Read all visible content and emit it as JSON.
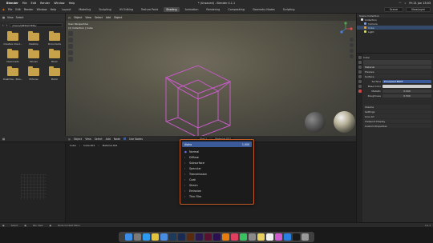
{
  "menubar": {
    "app_name": "Blender",
    "items": [
      "File",
      "Edit",
      "Render",
      "Window",
      "Help"
    ],
    "title": "* (Unsaved) - Blender 4.1.1",
    "clock": "Fri 21 Jun 13:03"
  },
  "topbar": {
    "menus": [
      "File",
      "Edit",
      "Render",
      "Window",
      "Help"
    ],
    "tabs": [
      "Layout",
      "Modeling",
      "Sculpting",
      "UV Editing",
      "Texture Paint",
      "Shading",
      "Animation",
      "Rendering",
      "Compositing",
      "Geometry Nodes",
      "Scripting"
    ],
    "active_tab": "Shading",
    "scene": "Scene",
    "view_layer": "ViewLayer"
  },
  "filebrowser": {
    "menus": [
      "View",
      "Select"
    ],
    "path": "/Users/[REDACTED]/",
    "folders": [
      "Creative Cloud...",
      "Desktop",
      "Documents",
      "Downloads",
      "Movies",
      "Music",
      "OneDrive - Pers...",
      "Pictures",
      "Public"
    ]
  },
  "viewport": {
    "menus": [
      "Object",
      "View",
      "Select",
      "Add",
      "Object"
    ],
    "info_line1": "User Perspective",
    "info_line2": "(1) Collection | Cube"
  },
  "outliner": {
    "title": "Scene Collection",
    "rows": [
      "Collection",
      "Camera",
      "Cube",
      "Light"
    ]
  },
  "properties": {
    "object_name": "Cube",
    "material": "Material",
    "sections": [
      "Preview",
      "Surface",
      "Volume",
      "Settings",
      "Line Art",
      "Viewport Display",
      "Custom Properties"
    ],
    "surface_label": "Surface",
    "surface_value": "Principled BSDF",
    "fields": [
      {
        "label": "Base Color",
        "value": ""
      },
      {
        "label": "Metallic",
        "value": "0.000"
      },
      {
        "label": "Roughness",
        "value": "0.500"
      }
    ]
  },
  "shader": {
    "header_menus": [
      "Object",
      "View",
      "Select",
      "Add",
      "Node"
    ],
    "use_nodes_label": "Use Nodes",
    "slot": "Slot 1",
    "material": "Material.001",
    "sub_items": [
      "Cube",
      "Cube.001",
      "Material.001"
    ]
  },
  "dropdown": {
    "search_value": "Alpha",
    "search_result": "1.000",
    "items": [
      {
        "label": "Normal",
        "expandable": false
      },
      {
        "label": "Diffuse",
        "expandable": true
      },
      {
        "label": "Subsurface",
        "expandable": true
      },
      {
        "label": "Specular",
        "expandable": true
      },
      {
        "label": "Transmission",
        "expandable": true
      },
      {
        "label": "Coat",
        "expandable": true
      },
      {
        "label": "Sheen",
        "expandable": true
      },
      {
        "label": "Emission",
        "expandable": true
      },
      {
        "label": "Thin Film",
        "expandable": true
      }
    ]
  },
  "status": {
    "left": "Select",
    "mid": "Pan View",
    "right": "Node Context Menu",
    "version": "4.1.1"
  },
  "colors": {
    "accent": "#c15a25",
    "selection_blue": "#3a5a9a",
    "wire": "#c45bc4",
    "folder": "#c8a24a"
  }
}
